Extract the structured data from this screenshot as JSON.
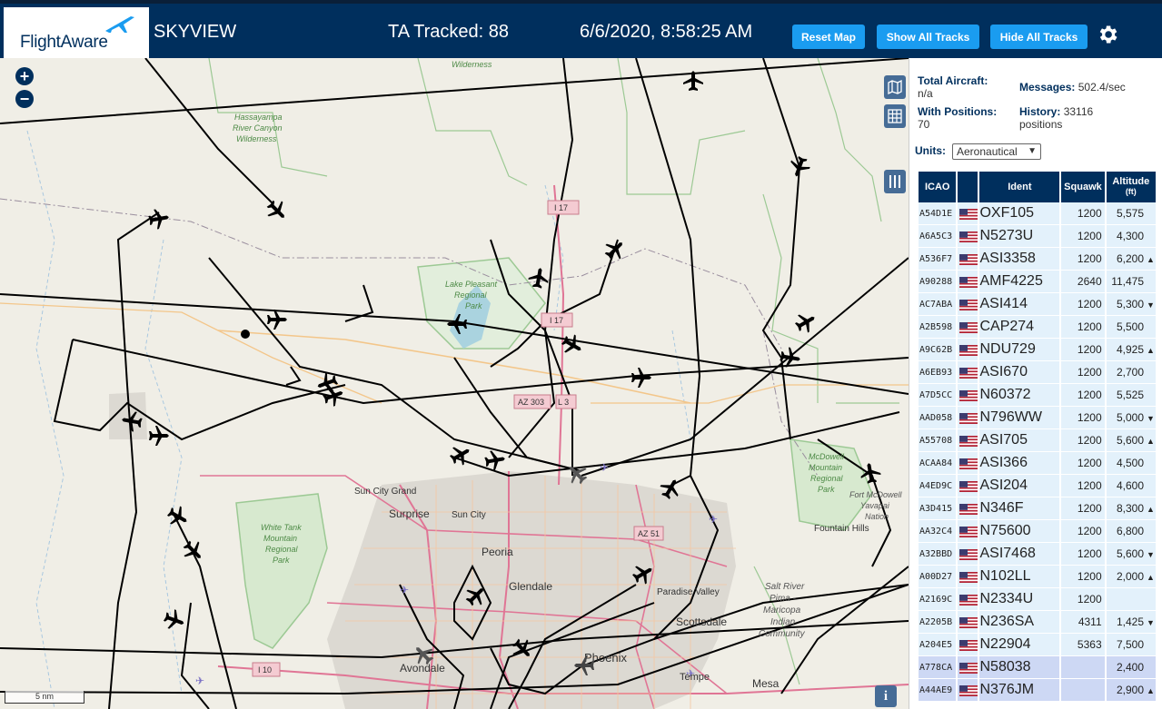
{
  "header": {
    "logo_text": "FlightAware",
    "site_name": "SKYVIEW",
    "tracked": "TA Tracked: 88",
    "clock": "6/6/2020, 8:58:25 AM",
    "reset_label": "Reset Map",
    "show_label": "Show All Tracks",
    "hide_label": "Hide All Tracks"
  },
  "map": {
    "zoom_in": "+",
    "zoom_out": "−",
    "scale": "5 nm",
    "info": "i",
    "labels": {
      "wilderness_top": "Wilderness",
      "hassayampa": [
        "Hassayampa",
        "River Canyon",
        "Wilderness"
      ],
      "lake_pleasant": [
        "Lake Pleasant",
        "Regional",
        "Park"
      ],
      "white_tank": [
        "White Tank",
        "Mountain",
        "Regional",
        "Park"
      ],
      "mcdowell": [
        "McDowell",
        "Mountain",
        "Regional",
        "Park"
      ],
      "fort_mcdowell": [
        "Fort McDowell",
        "Yavapai",
        "Nation"
      ],
      "salt_river": [
        "Salt River",
        "Pima -",
        "Maricopa",
        "Indian",
        "Community"
      ],
      "sun_city_grand": "Sun City Grand",
      "surprise": "Surprise",
      "sun_city": "Sun City",
      "peoria": "Peoria",
      "glendale": "Glendale",
      "paradise_valley": "Paradise Valley",
      "scottsdale": "Scottsdale",
      "phoenix": "Phoenix",
      "avondale": "Avondale",
      "tempe": "Tempe",
      "mesa": "Mesa",
      "fountain_hills": "Fountain Hills",
      "i17_a": "I 17",
      "i17_b": "I 17",
      "az303": "AZ 303",
      "az51": "AZ 51",
      "i10": "I 10",
      "l303": "L 3"
    }
  },
  "stats": {
    "total_label": "Total Aircraft:",
    "total_value": "n/a",
    "messages_label": "Messages:",
    "messages_value": "502.4/sec",
    "withpos_label": "With Positions:",
    "withpos_value": "70",
    "history_label": "History:",
    "history_value": "33116",
    "history_unit": "positions",
    "units_label": "Units:",
    "units_value": "Aeronautical"
  },
  "table": {
    "columns": [
      "ICAO",
      "",
      "Ident",
      "Squawk",
      "Altitude (ft)"
    ],
    "col_altitude_line1": "Altitude",
    "col_altitude_line2": "(ft)",
    "rows": [
      {
        "icao": "A54D1E",
        "ident": "OXF105",
        "squawk": "1200",
        "alt": "5,575",
        "trend": "",
        "sel": false
      },
      {
        "icao": "A6A5C3",
        "ident": "N5273U",
        "squawk": "1200",
        "alt": "4,300",
        "trend": "",
        "sel": false
      },
      {
        "icao": "A536F7",
        "ident": "ASI3358",
        "squawk": "1200",
        "alt": "6,200",
        "trend": "▲",
        "sel": false
      },
      {
        "icao": "A90288",
        "ident": "AMF4225",
        "squawk": "2640",
        "alt": "11,475",
        "trend": "",
        "sel": false
      },
      {
        "icao": "AC7ABA",
        "ident": "ASI414",
        "squawk": "1200",
        "alt": "5,300",
        "trend": "▼",
        "sel": false
      },
      {
        "icao": "A2B598",
        "ident": "CAP274",
        "squawk": "1200",
        "alt": "5,500",
        "trend": "",
        "sel": false
      },
      {
        "icao": "A9C62B",
        "ident": "NDU729",
        "squawk": "1200",
        "alt": "4,925",
        "trend": "▲",
        "sel": false
      },
      {
        "icao": "A6EB93",
        "ident": "ASI670",
        "squawk": "1200",
        "alt": "2,700",
        "trend": "",
        "sel": false
      },
      {
        "icao": "A7D5CC",
        "ident": "N60372",
        "squawk": "1200",
        "alt": "5,525",
        "trend": "",
        "sel": false
      },
      {
        "icao": "AAD058",
        "ident": "N796WW",
        "squawk": "1200",
        "alt": "5,000",
        "trend": "▼",
        "sel": false
      },
      {
        "icao": "A55708",
        "ident": "ASI705",
        "squawk": "1200",
        "alt": "5,600",
        "trend": "▲",
        "sel": false
      },
      {
        "icao": "ACAA84",
        "ident": "ASI366",
        "squawk": "1200",
        "alt": "4,500",
        "trend": "",
        "sel": false
      },
      {
        "icao": "A4ED9C",
        "ident": "ASI204",
        "squawk": "1200",
        "alt": "4,600",
        "trend": "",
        "sel": false
      },
      {
        "icao": "A3D415",
        "ident": "N346F",
        "squawk": "1200",
        "alt": "8,300",
        "trend": "▲",
        "sel": false
      },
      {
        "icao": "AA32C4",
        "ident": "N75600",
        "squawk": "1200",
        "alt": "6,800",
        "trend": "",
        "sel": false
      },
      {
        "icao": "A32BBD",
        "ident": "ASI7468",
        "squawk": "1200",
        "alt": "5,600",
        "trend": "▼",
        "sel": false
      },
      {
        "icao": "A00D27",
        "ident": "N102LL",
        "squawk": "1200",
        "alt": "2,000",
        "trend": "▲",
        "sel": false
      },
      {
        "icao": "A2169C",
        "ident": "N2334U",
        "squawk": "1200",
        "alt": "",
        "trend": "",
        "sel": false
      },
      {
        "icao": "A2205B",
        "ident": "N236SA",
        "squawk": "4311",
        "alt": "1,425",
        "trend": "▼",
        "sel": false
      },
      {
        "icao": "A204E5",
        "ident": "N22904",
        "squawk": "5363",
        "alt": "7,500",
        "trend": "",
        "sel": false
      },
      {
        "icao": "A778CA",
        "ident": "N58038",
        "squawk": "",
        "alt": "2,400",
        "trend": "",
        "sel": true
      },
      {
        "icao": "A44AE9",
        "ident": "N376JM",
        "squawk": "",
        "alt": "2,900",
        "trend": "▲",
        "sel": true
      }
    ]
  },
  "icons": {
    "flag": "us-flag-icon",
    "gear": "gear-icon",
    "aircraft": "airplane-icon"
  },
  "colors": {
    "header_bg": "#002f5d",
    "button_bg": "#1a9cf0",
    "row_bg": "#e3f1fb",
    "row_selected_bg": "#cdd8f4",
    "map_bg": "#f0eee6",
    "park_green": "#8fc78a",
    "highway_pink": "#e07595"
  }
}
